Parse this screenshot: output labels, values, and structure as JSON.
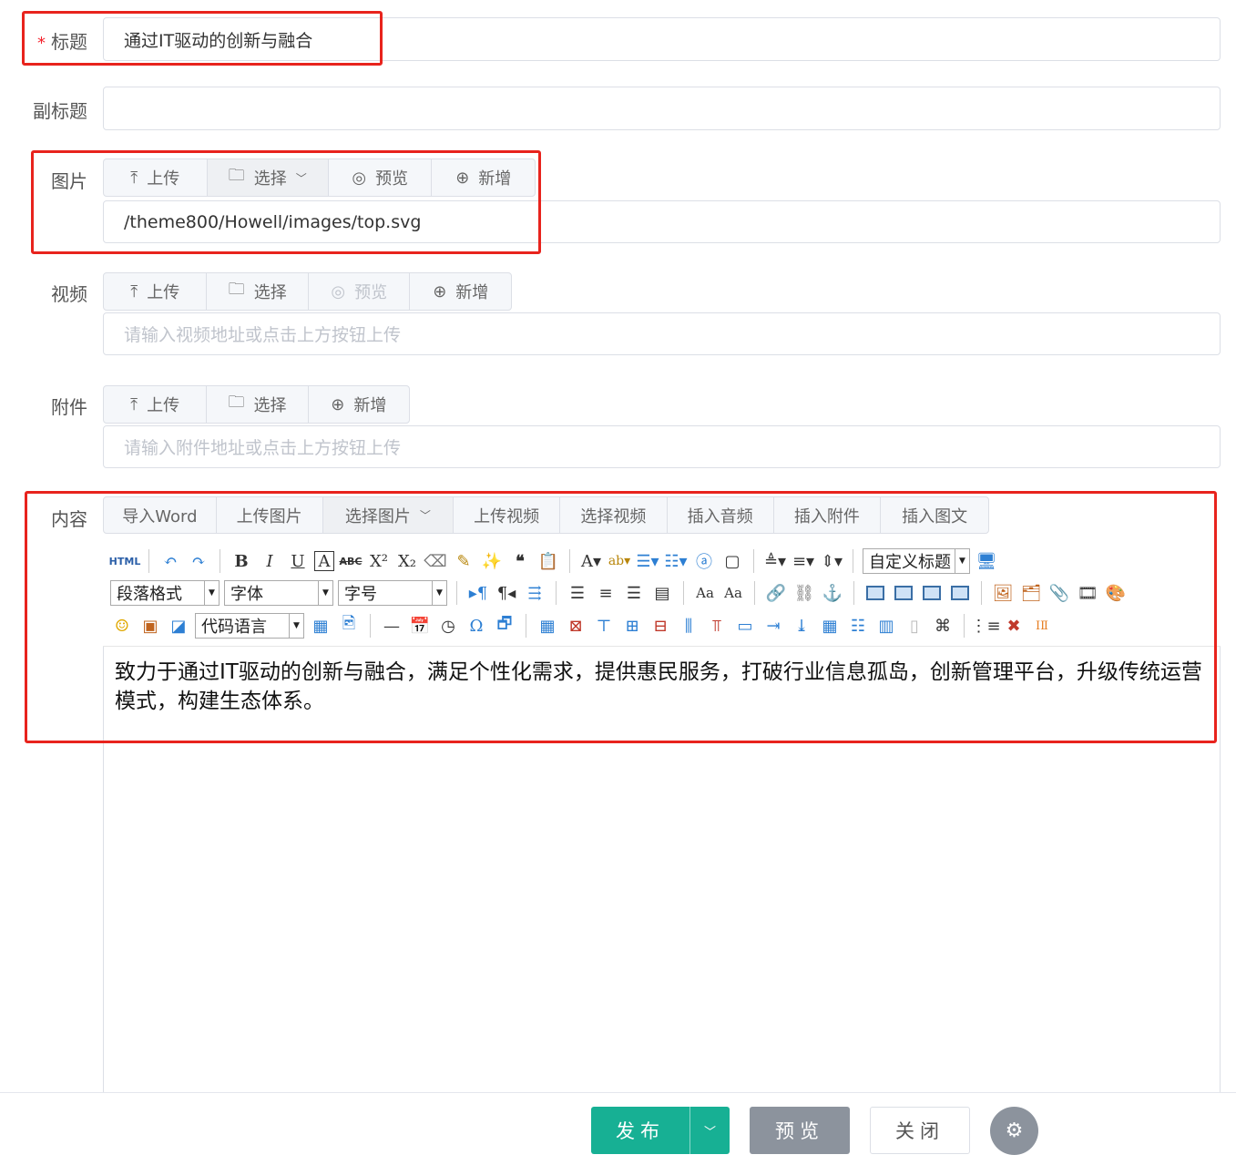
{
  "form": {
    "title": {
      "label": "标题",
      "required_mark": "*",
      "value": "通过IT驱动的创新与融合"
    },
    "subtitle": {
      "label": "副标题",
      "value": ""
    },
    "image": {
      "label": "图片",
      "buttons": [
        "上传",
        "选择",
        "预览",
        "新增"
      ],
      "value": "/theme800/Howell/images/top.svg"
    },
    "video": {
      "label": "视频",
      "buttons": [
        "上传",
        "选择",
        "预览",
        "新增"
      ],
      "placeholder": "请输入视频地址或点击上方按钮上传"
    },
    "attachment": {
      "label": "附件",
      "buttons": [
        "上传",
        "选择",
        "新增"
      ],
      "placeholder": "请输入附件地址或点击上方按钮上传"
    },
    "content": {
      "label": "内容",
      "tabs": [
        "导入Word",
        "上传图片",
        "选择图片",
        "上传视频",
        "选择视频",
        "插入音频",
        "插入附件",
        "插入图文"
      ],
      "toolbar": {
        "html_icon": "HTML",
        "custom_heading": "自定义标题",
        "paragraph": "段落格式",
        "font": "字体",
        "font_size": "字号",
        "code_lang": "代码语言"
      },
      "text": "致力于通过IT驱动的创新与融合，满足个性化需求，提供惠民服务，打破行业信息孤岛，创新管理平台，升级传统运营模式，构建生态体系。"
    }
  },
  "footer": {
    "publish": "发布",
    "preview": "预览",
    "close": "关闭"
  },
  "colors": {
    "primary": "#17b094",
    "preview": "#8c939d",
    "highlight": "#e8231d"
  }
}
